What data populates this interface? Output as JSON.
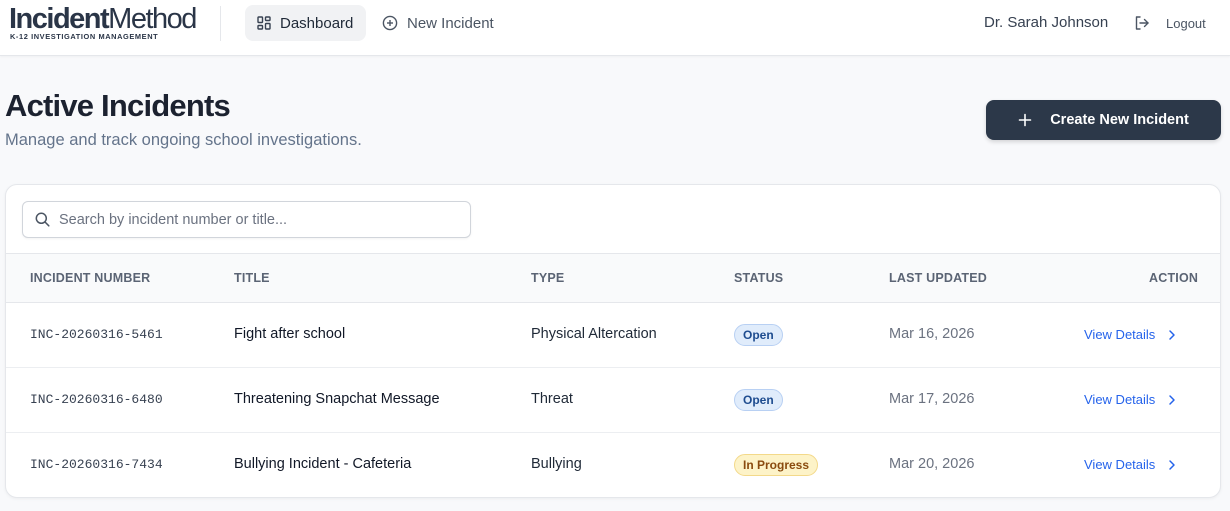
{
  "brand": {
    "logo_bold": "Incident",
    "logo_regular": "Method",
    "tagline": "K-12 INVESTIGATION MANAGEMENT"
  },
  "nav": {
    "dashboard_label": "Dashboard",
    "dashboard_icon": "dashboard-grid-icon",
    "new_incident_label": "New Incident",
    "new_incident_icon": "plus-circle-icon"
  },
  "user": {
    "name": "Dr. Sarah Johnson",
    "logout_label": "Logout",
    "logout_icon": "logout-icon"
  },
  "page": {
    "title": "Active Incidents",
    "subtitle": "Manage and track ongoing school investigations.",
    "create_button_label": "Create New Incident",
    "create_button_icon": "plus-icon"
  },
  "search": {
    "placeholder": "Search by incident number or title...",
    "value": "",
    "icon": "search-icon"
  },
  "table": {
    "columns": [
      "INCIDENT NUMBER",
      "TITLE",
      "TYPE",
      "STATUS",
      "LAST UPDATED",
      "ACTION"
    ],
    "rows": [
      {
        "number": "INC-20260316-5461",
        "title": "Fight after school",
        "type": "Physical Altercation",
        "status": "Open",
        "updated": "Mar 16, 2026",
        "action": "View Details"
      },
      {
        "number": "INC-20260316-6480",
        "title": "Threatening Snapchat Message",
        "type": "Threat",
        "status": "Open",
        "updated": "Mar 17, 2026",
        "action": "View Details"
      },
      {
        "number": "INC-20260316-7434",
        "title": "Bullying Incident - Cafeteria",
        "type": "Bullying",
        "status": "In Progress",
        "updated": "Mar 20, 2026",
        "action": "View Details"
      }
    ]
  },
  "colors": {
    "brand_navy": "#2c3849",
    "link_blue": "#2563eb",
    "status_open_bg": "#e0ecfb",
    "status_progress_bg": "#fdf3c8"
  }
}
